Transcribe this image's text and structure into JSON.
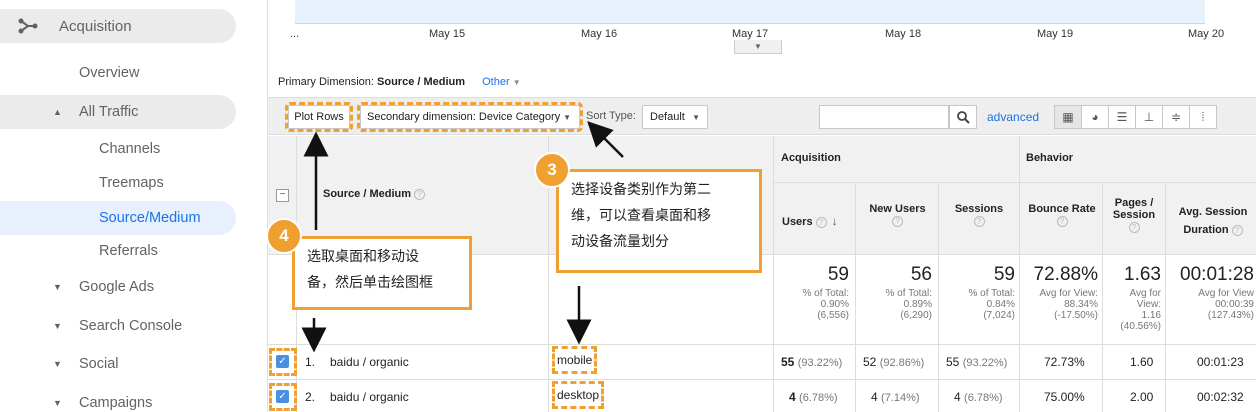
{
  "sidebar": {
    "acquisition": "Acquisition",
    "overview": "Overview",
    "all_traffic": "All Traffic",
    "channels": "Channels",
    "treemaps": "Treemaps",
    "source_medium": "Source/Medium",
    "referrals": "Referrals",
    "google_ads": "Google Ads",
    "search_console": "Search Console",
    "social": "Social",
    "campaigns": "Campaigns"
  },
  "chart": {
    "x_labels": [
      "...",
      "May 15",
      "May 16",
      "May 17",
      "May 18",
      "May 19",
      "May 20"
    ]
  },
  "primary_dimension": {
    "label": "Primary Dimension:",
    "value": "Source / Medium",
    "other": "Other"
  },
  "toolbar": {
    "plot_rows": "Plot Rows",
    "secondary_dimension": "Secondary dimension: Device Category",
    "sort_type_label": "Sort Type:",
    "sort_type_value": "Default",
    "advanced": "advanced"
  },
  "table": {
    "col_source_medium": "Source / Medium",
    "group_acquisition": "Acquisition",
    "group_behavior": "Behavior",
    "col_users": "Users",
    "col_new_users": "New Users",
    "col_sessions": "Sessions",
    "col_bounce_rate": "Bounce Rate",
    "col_pages_session_1": "Pages /",
    "col_pages_session_2": "Session",
    "col_avg_session_1": "Avg. Session",
    "col_avg_session_2": "Duration",
    "totals": {
      "users": "59",
      "users_sub1": "% of Total:",
      "users_sub2": "0.90%",
      "users_sub3": "(6,556)",
      "new_users": "56",
      "new_users_sub1": "% of Total:",
      "new_users_sub2": "0.89%",
      "new_users_sub3": "(6,290)",
      "sessions": "59",
      "sessions_sub1": "% of Total:",
      "sessions_sub2": "0.84%",
      "sessions_sub3": "(7,024)",
      "bounce_rate": "72.88%",
      "bounce_sub1": "Avg for View:",
      "bounce_sub2": "88.34%",
      "bounce_sub3": "(-17.50%)",
      "pages": "1.63",
      "pages_sub1": "Avg for",
      "pages_sub2": "View:",
      "pages_sub3": "1.16",
      "pages_sub4": "(40.56%)",
      "duration": "00:01:28",
      "duration_sub1": "Avg for View",
      "duration_sub2": "00:00:39",
      "duration_sub3": "(127.43%)"
    },
    "rows": [
      {
        "index": "1.",
        "source": "baidu / organic",
        "device": "mobile",
        "users": "55",
        "users_pct": "(93.22%)",
        "new_users": "52",
        "new_users_pct": "(92.86%)",
        "sessions": "55",
        "sessions_pct": "(93.22%)",
        "bounce_rate": "72.73%",
        "pages": "1.60",
        "duration": "00:01:23"
      },
      {
        "index": "2.",
        "source": "baidu / organic",
        "device": "desktop",
        "users": "4",
        "users_pct": "(6.78%)",
        "new_users": "4",
        "new_users_pct": "(7.14%)",
        "sessions": "4",
        "sessions_pct": "(6.78%)",
        "bounce_rate": "75.00%",
        "pages": "2.00",
        "duration": "00:02:32"
      }
    ]
  },
  "annotations": {
    "step3_number": "3",
    "step3_line1": "选择设备类别作为第二",
    "step3_line2": "维，可以查看桌面和移",
    "step3_line3": "动设备流量划分",
    "step4_number": "4",
    "step4_line1": "选取桌面和移动设",
    "step4_line2": "备，然后单击绘图框"
  },
  "colors": {
    "accent_orange": "#f0a030",
    "link_blue": "#1a73e8",
    "checkbox_blue": "#4a90e2"
  }
}
